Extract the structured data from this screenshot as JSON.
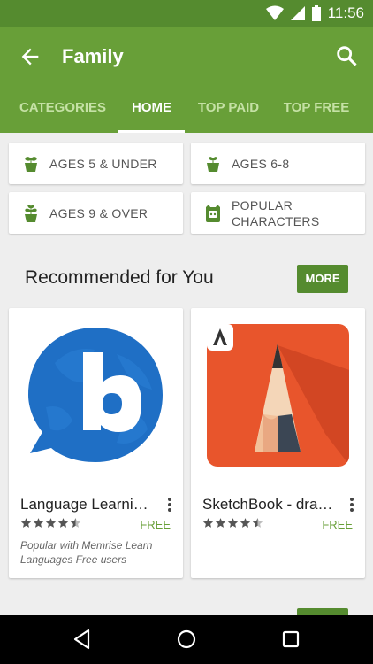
{
  "status_bar": {
    "time": "11:56"
  },
  "app_bar": {
    "title": "Family"
  },
  "tabs": [
    {
      "label": "CATEGORIES",
      "active": false
    },
    {
      "label": "HOME",
      "active": true
    },
    {
      "label": "TOP PAID",
      "active": false
    },
    {
      "label": "TOP FREE",
      "active": false
    }
  ],
  "age_chips": [
    {
      "label": "AGES 5 & UNDER",
      "icon": "sprout-icon"
    },
    {
      "label": "AGES 6-8",
      "icon": "sprout-icon"
    },
    {
      "label": "AGES 9 & OVER",
      "icon": "sprout-icon"
    },
    {
      "label_line1": "POPULAR",
      "label_line2": "CHARACTERS",
      "icon": "character-icon"
    }
  ],
  "recommended": {
    "title": "Recommended for You",
    "more_label": "MORE",
    "apps": [
      {
        "name": "Language Learni…",
        "rating": 4.5,
        "price": "FREE",
        "note": "Popular with Memrise Learn Languages Free users",
        "icon": "busuu-logo-icon"
      },
      {
        "name": "SketchBook - dra…",
        "rating": 4.5,
        "price": "FREE",
        "note": "",
        "icon": "sketchbook-logo-icon"
      }
    ]
  },
  "colors": {
    "primary": "#689f38",
    "primary_dark": "#558b2f",
    "tab_inactive": "#c5e1a5",
    "busuu_blue": "#1f6fc5",
    "sketch_orange": "#e8552c"
  }
}
